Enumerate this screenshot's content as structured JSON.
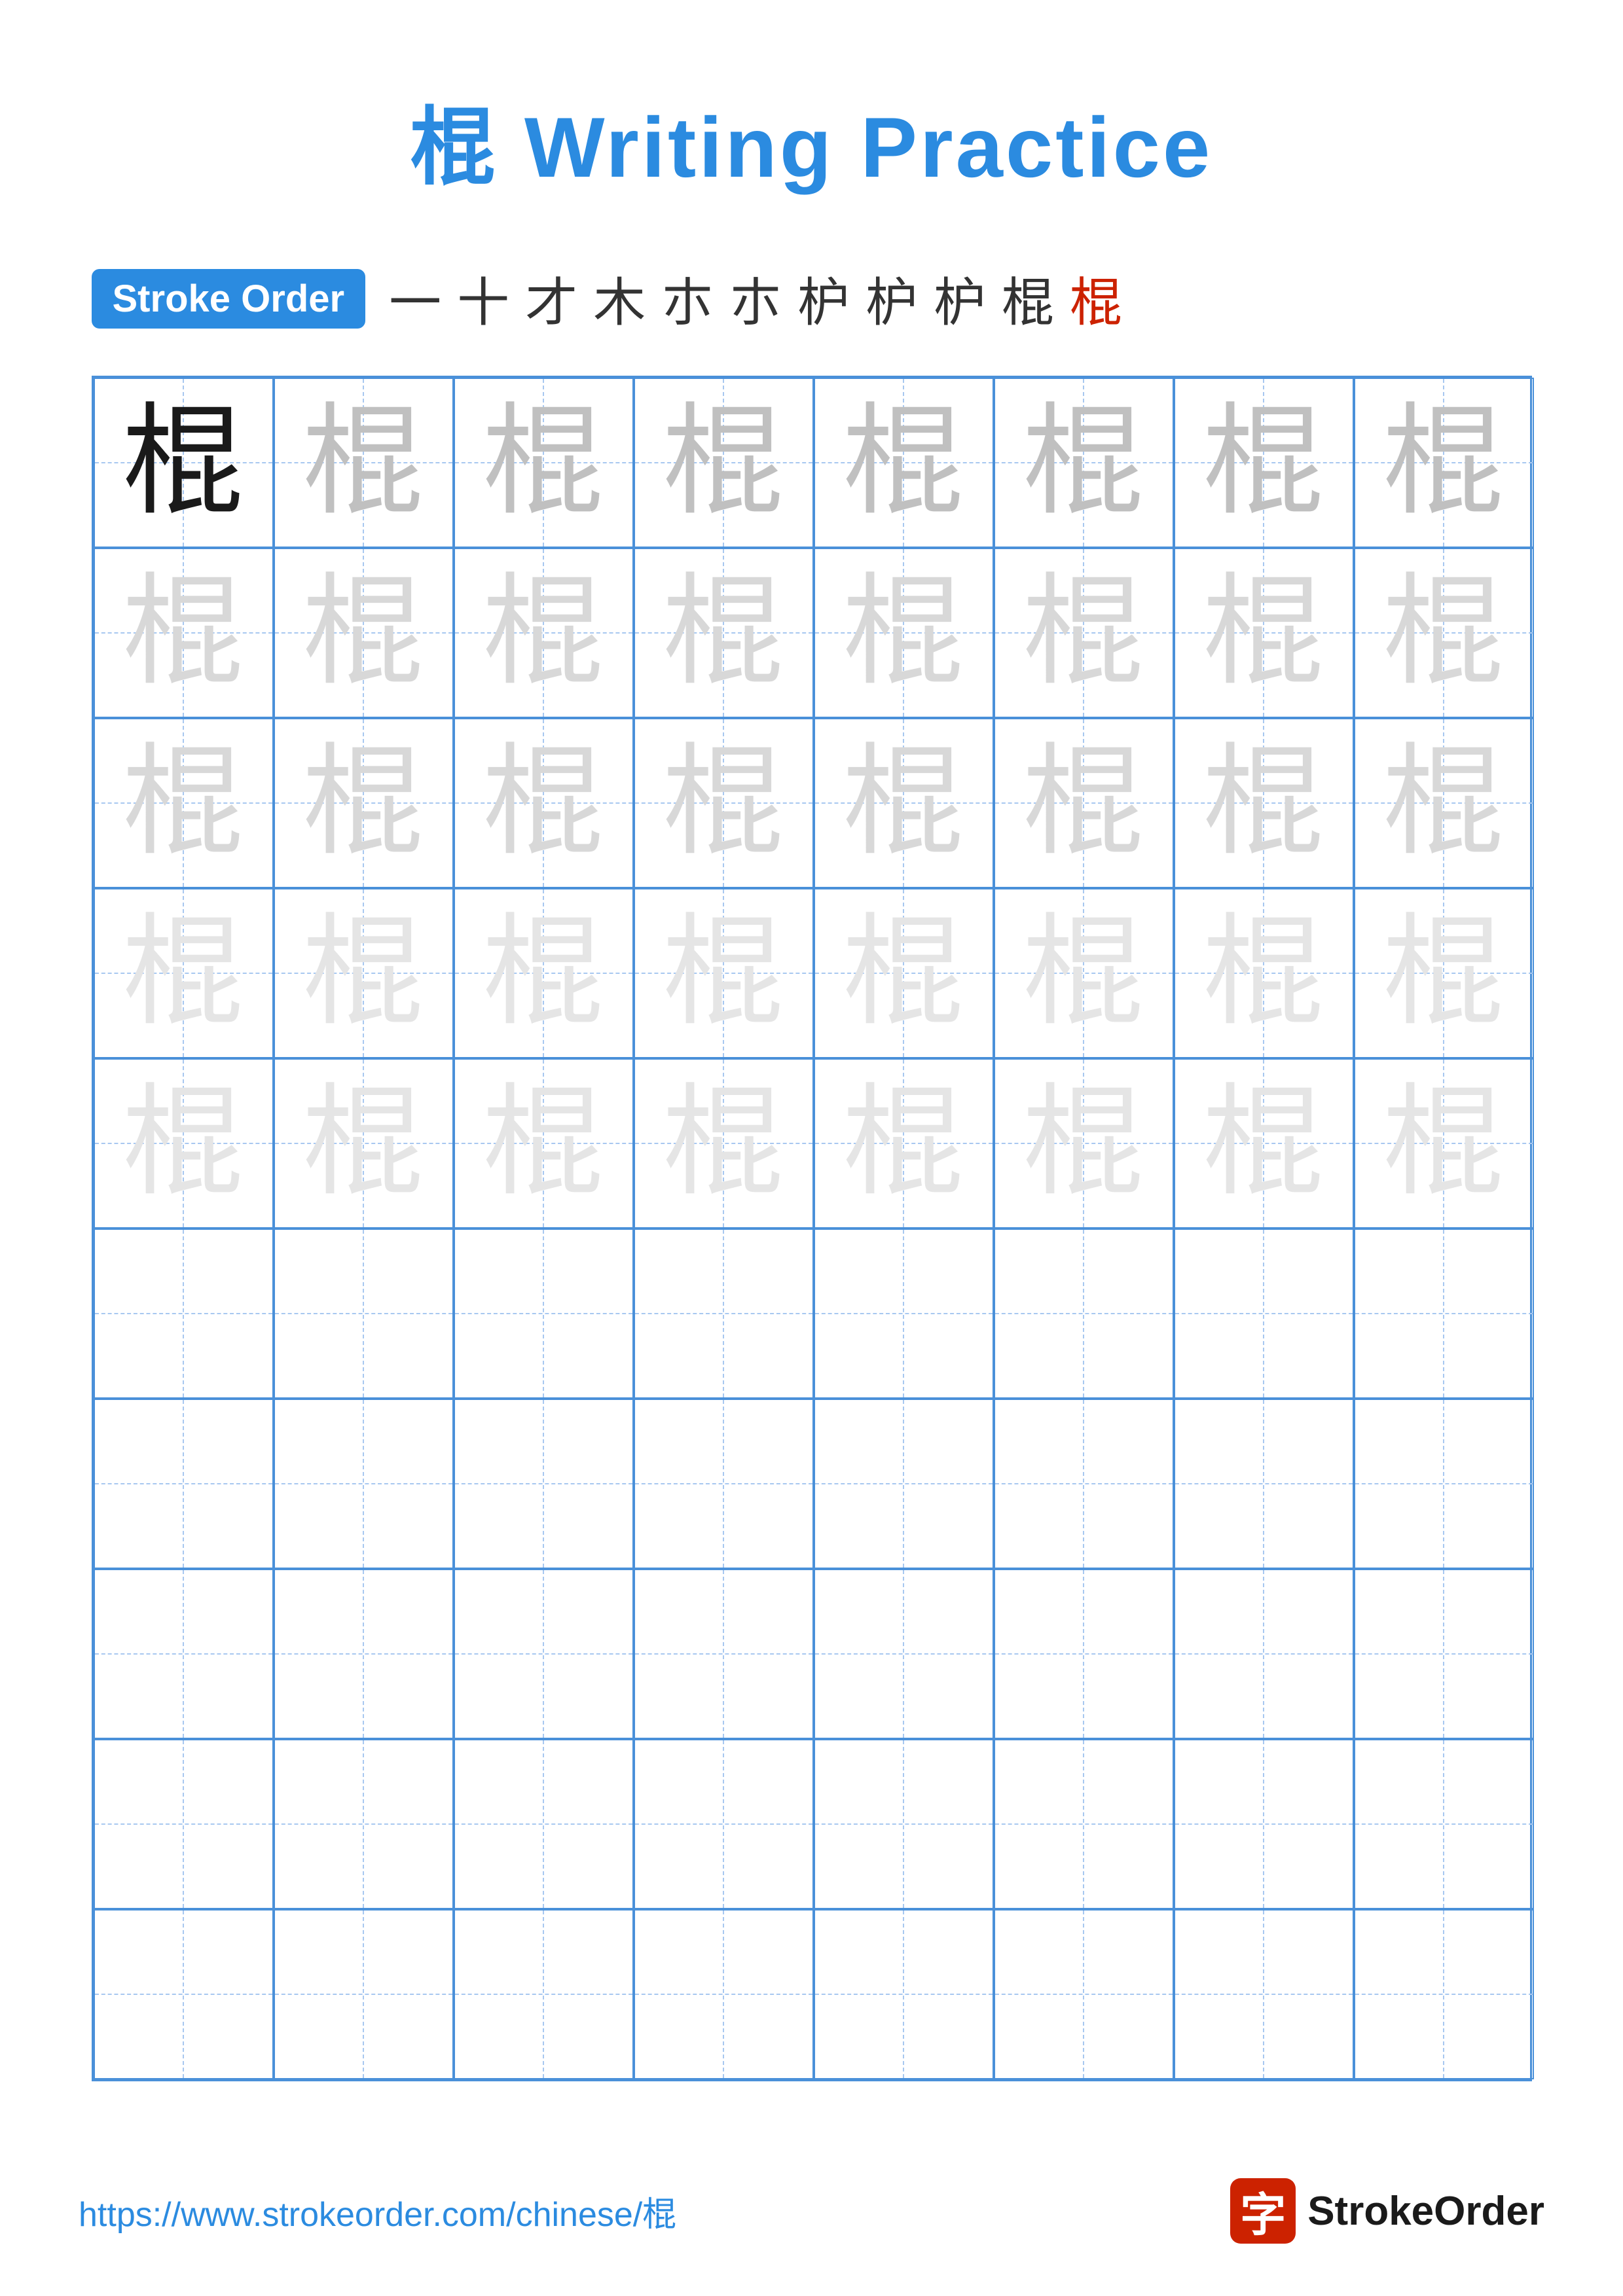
{
  "title": "棍 Writing Practice",
  "stroke_order_badge": "Stroke Order",
  "stroke_sequence": [
    "一",
    "十",
    "才",
    "木",
    "朩",
    "朩",
    "枦",
    "枦",
    "枦",
    "棍",
    "棍"
  ],
  "character": "棍",
  "grid": {
    "cols": 8,
    "rows": 10,
    "practice_rows": [
      [
        "dark",
        "medium",
        "medium",
        "medium",
        "medium",
        "medium",
        "medium",
        "medium"
      ],
      [
        "light",
        "light",
        "light",
        "light",
        "light",
        "light",
        "light",
        "light"
      ],
      [
        "light",
        "light",
        "light",
        "light",
        "light",
        "light",
        "light",
        "light"
      ],
      [
        "very-light",
        "very-light",
        "very-light",
        "very-light",
        "very-light",
        "very-light",
        "very-light",
        "very-light"
      ],
      [
        "very-light",
        "very-light",
        "very-light",
        "very-light",
        "very-light",
        "very-light",
        "very-light",
        "very-light"
      ],
      [
        "empty",
        "empty",
        "empty",
        "empty",
        "empty",
        "empty",
        "empty",
        "empty"
      ],
      [
        "empty",
        "empty",
        "empty",
        "empty",
        "empty",
        "empty",
        "empty",
        "empty"
      ],
      [
        "empty",
        "empty",
        "empty",
        "empty",
        "empty",
        "empty",
        "empty",
        "empty"
      ],
      [
        "empty",
        "empty",
        "empty",
        "empty",
        "empty",
        "empty",
        "empty",
        "empty"
      ],
      [
        "empty",
        "empty",
        "empty",
        "empty",
        "empty",
        "empty",
        "empty",
        "empty"
      ]
    ]
  },
  "footer": {
    "url": "https://www.strokeorder.com/chinese/棍",
    "brand_char": "字",
    "brand_name": "StrokeOrder"
  }
}
